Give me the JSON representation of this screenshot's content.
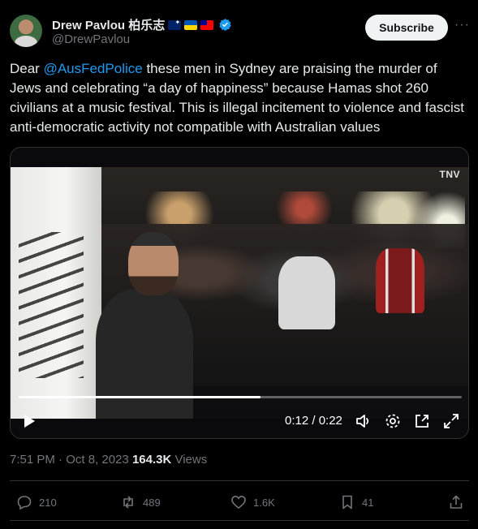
{
  "author": {
    "display_name": "Drew Pavlou 柏乐志",
    "handle": "@DrewPavlou",
    "flags": [
      "australia-flag",
      "ukraine-flag",
      "taiwan-flag"
    ],
    "verified_icon": "verified-badge-icon",
    "subscribe_label": "Subscribe",
    "more_icon": "more-options-icon",
    "more_glyph": "···"
  },
  "tweet": {
    "text_before_mention": "Dear ",
    "mention": "@AusFedPolice",
    "text_after_mention": " these men in Sydney are praising the murder of Jews and celebrating “a day of happiness” because Hamas shot 260 civilians at a music festival. This is illegal incitement to violence and fascist anti-democratic activity not compatible with Australian values"
  },
  "video": {
    "watermark": "TNV",
    "timecode": "0:12 / 0:22",
    "progress_fraction": 0.545,
    "controls": [
      "play-icon",
      "volume-icon",
      "settings-icon",
      "pop-out-icon",
      "fullscreen-icon"
    ]
  },
  "meta": {
    "time": "7:51 PM",
    "separator": " · ",
    "date": "Oct 8, 2023",
    "views_count": "164.3K",
    "views_label": " Views"
  },
  "actions": {
    "replies": "210",
    "reposts": "489",
    "likes": "1.6K",
    "bookmarks": "41"
  },
  "colors": {
    "background": "#000000",
    "text": "#e7e9ea",
    "secondary": "#71767b",
    "accent": "#1d9bf0",
    "border": "#2f3336"
  }
}
